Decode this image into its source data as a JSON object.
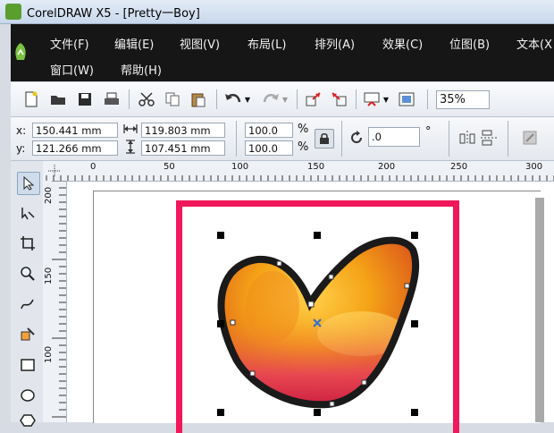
{
  "window": {
    "title": "CorelDRAW X5 - [Pretty一Boy]"
  },
  "menu": {
    "row1": [
      "文件(F)",
      "编辑(E)",
      "视图(V)",
      "布局(L)",
      "排列(A)",
      "效果(C)",
      "位图(B)",
      "文本(X"
    ],
    "row2": [
      "窗口(W)",
      "帮助(H)"
    ]
  },
  "toolbar": {
    "zoom": "35%"
  },
  "property_bar": {
    "x_label": "x:",
    "x_value": "150.441 mm",
    "y_label": "y:",
    "y_value": "121.266 mm",
    "width_value": "119.803 mm",
    "height_value": "107.451 mm",
    "scale_w": "100.0",
    "scale_h": "100.0",
    "percent": "%",
    "rotation": ".0",
    "degree": "°"
  },
  "ruler": {
    "h_labels": [
      "0",
      "50",
      "100",
      "150",
      "200",
      "250",
      "300"
    ],
    "v_labels": [
      "200",
      "150",
      "100"
    ]
  },
  "colors": {
    "frame": "#f0185a",
    "outline": "#1a1a1a",
    "accent": "#2f6fd6"
  },
  "icons": {
    "toolbox": [
      "pick-icon",
      "shape-icon",
      "crop-icon",
      "zoom-icon",
      "freehand-icon",
      "smart-fill-icon",
      "rectangle-icon",
      "ellipse-icon",
      "polygon-icon"
    ]
  }
}
